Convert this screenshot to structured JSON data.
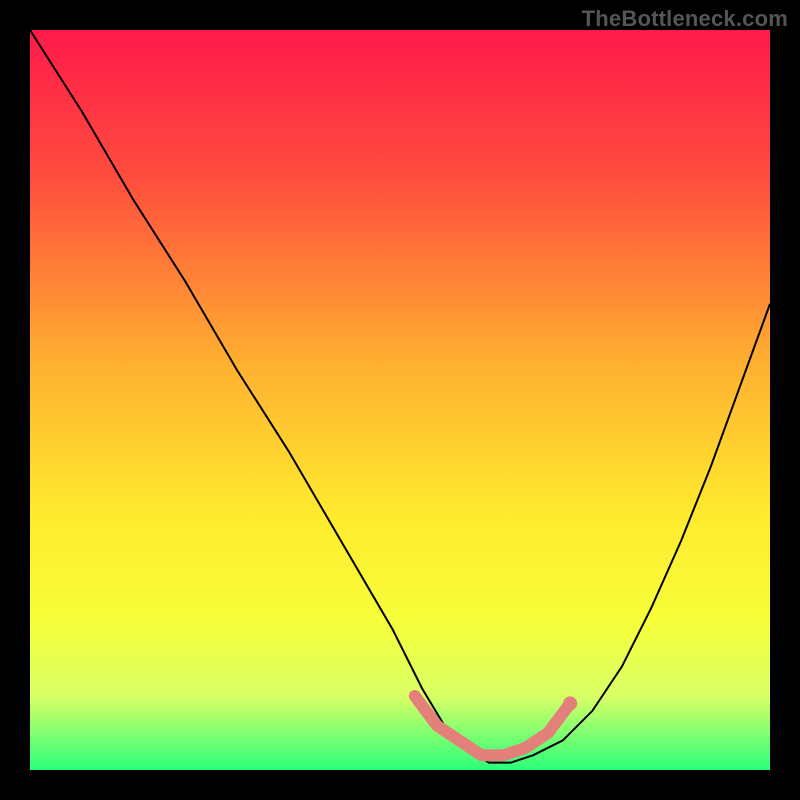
{
  "watermark": "TheBottleneck.com",
  "chart_data": {
    "type": "line",
    "title": "",
    "xlabel": "",
    "ylabel": "",
    "xlim": [
      0,
      100
    ],
    "ylim": [
      0,
      100
    ],
    "grid": false,
    "legend": false,
    "background_gradient": {
      "stops": [
        {
          "offset": 0.0,
          "color": "#ff1a4b"
        },
        {
          "offset": 0.2,
          "color": "#ff4d3d"
        },
        {
          "offset": 0.45,
          "color": "#ffb030"
        },
        {
          "offset": 0.65,
          "color": "#ffe92e"
        },
        {
          "offset": 0.8,
          "color": "#f7ff3a"
        },
        {
          "offset": 0.9,
          "color": "#d9ff66"
        },
        {
          "offset": 1.0,
          "color": "#2bff7a"
        }
      ]
    },
    "series": [
      {
        "name": "bottleneck-curve",
        "color": "#000000",
        "x": [
          0,
          7,
          14,
          21,
          28,
          35,
          42,
          49,
          53,
          56,
          59,
          62,
          65,
          68,
          72,
          76,
          80,
          84,
          88,
          92,
          96,
          100
        ],
        "y": [
          100,
          89,
          77,
          66,
          54,
          43,
          31,
          19,
          11,
          6,
          3,
          1,
          1,
          2,
          4,
          8,
          14,
          22,
          31,
          41,
          52,
          63
        ]
      }
    ],
    "highlight": {
      "name": "optimal-zone",
      "color": "#e4807a",
      "x": [
        52,
        55,
        58,
        61,
        64,
        67,
        70,
        73
      ],
      "y": [
        10,
        6,
        4,
        2,
        2,
        3,
        5,
        9
      ]
    }
  }
}
